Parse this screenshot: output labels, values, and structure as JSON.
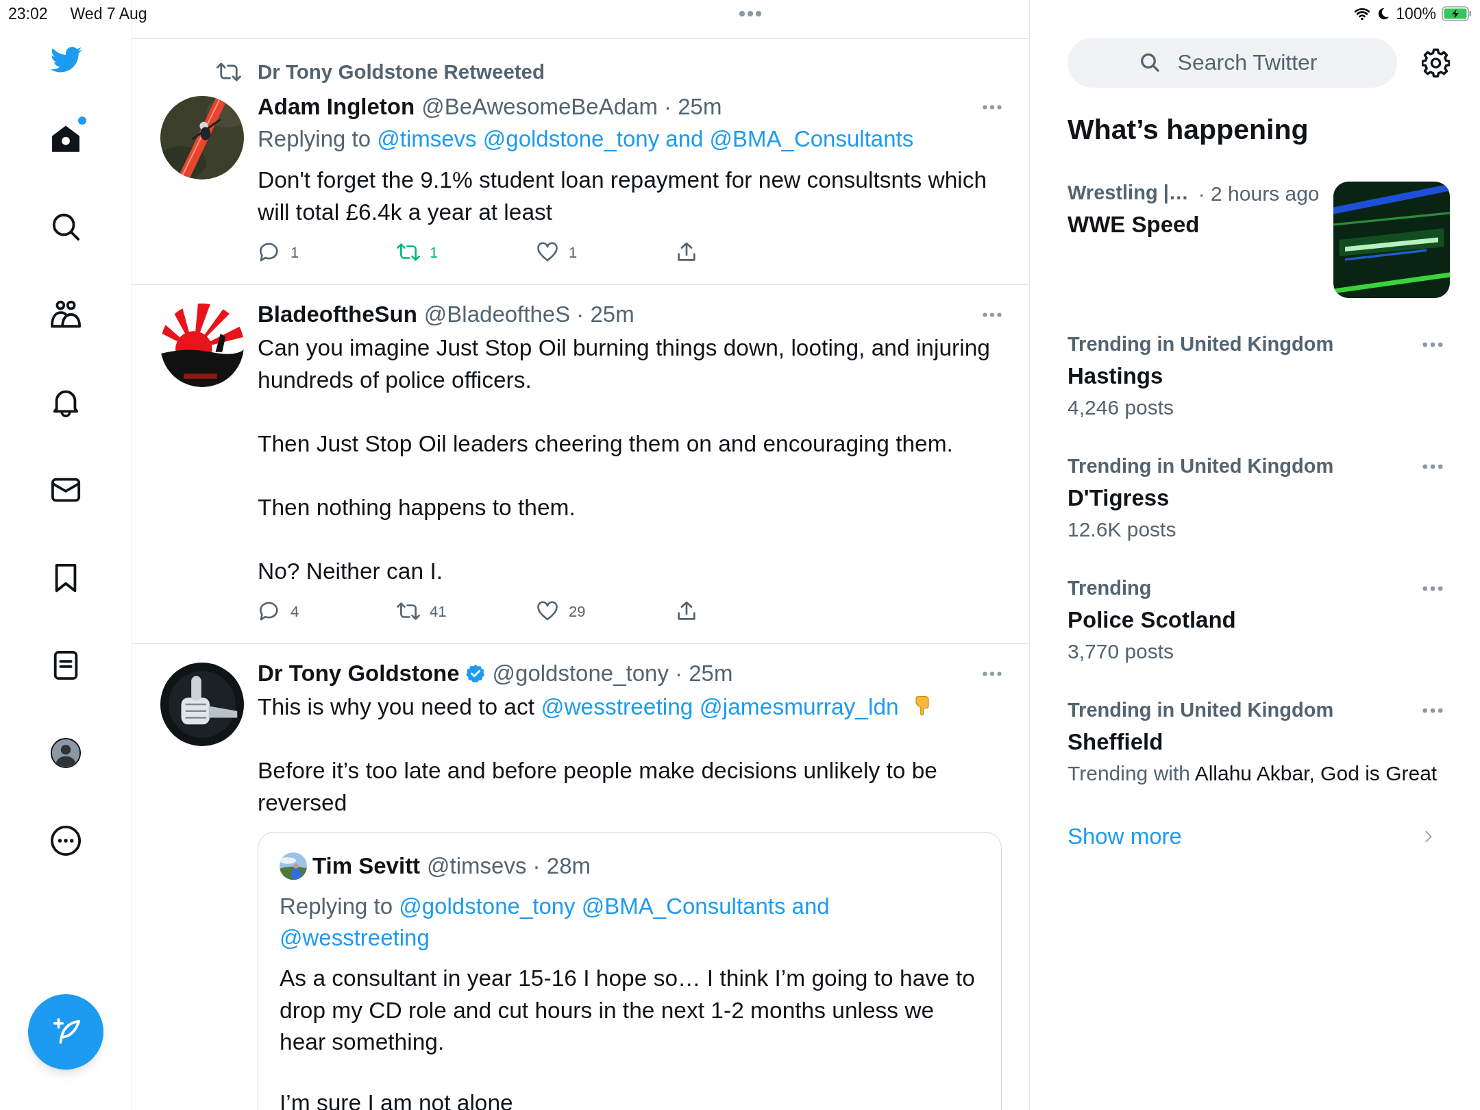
{
  "status_bar": {
    "time": "23:02",
    "date": "Wed 7 Aug",
    "battery": "100%"
  },
  "sidebar": {
    "items": [
      {
        "kind": "home",
        "selected": true,
        "unread": true
      },
      {
        "kind": "explore",
        "selected": false,
        "unread": false
      },
      {
        "kind": "communities",
        "selected": false,
        "unread": false
      },
      {
        "kind": "notifications",
        "selected": false,
        "unread": false
      },
      {
        "kind": "messages",
        "selected": false,
        "unread": false
      },
      {
        "kind": "bookmarks",
        "selected": false,
        "unread": false
      },
      {
        "kind": "lists",
        "selected": false,
        "unread": false
      },
      {
        "kind": "profile",
        "selected": false,
        "unread": false
      },
      {
        "kind": "more",
        "selected": false,
        "unread": false
      }
    ]
  },
  "feed": {
    "tweets": [
      {
        "retweeted_by": "Dr Tony Goldstone Retweeted",
        "name": "Adam Ingleton",
        "verified": false,
        "meta": "@BeAwesomeBeAdam · 25m",
        "replying_to": [
          {
            "kind": "plain",
            "text": "Replying to "
          },
          {
            "kind": "mention",
            "text": "@timsevs"
          },
          {
            "kind": "mention",
            "text": "@goldstone_tony"
          },
          {
            "kind": "accent",
            "text": " and "
          },
          {
            "kind": "mention",
            "text": "@BMA_Consultants"
          }
        ],
        "paragraphs": [
          [
            {
              "kind": "plain",
              "text": "Don't forget the 9.1% student loan repayment for new consultsnts which will total £6.4k a year at least"
            }
          ]
        ],
        "actions": {
          "replies": "1",
          "retweets": "1",
          "likes": "1",
          "retweeted": true,
          "liked": false
        }
      },
      {
        "name": "BladeoftheSun",
        "verified": false,
        "meta": "@BladeoftheS · 25m",
        "paragraphs": [
          [
            {
              "kind": "plain",
              "text": "Can you imagine Just Stop Oil burning things down, looting, and injuring hundreds of police officers."
            }
          ],
          [
            {
              "kind": "plain",
              "text": "Then Just Stop Oil leaders cheering them on and encouraging them."
            }
          ],
          [
            {
              "kind": "plain",
              "text": "Then nothing happens to them."
            }
          ],
          [
            {
              "kind": "plain",
              "text": "No? Neither can I."
            }
          ]
        ],
        "actions": {
          "replies": "4",
          "retweets": "41",
          "likes": "29",
          "retweeted": false,
          "liked": false
        }
      },
      {
        "name": "Dr Tony Goldstone",
        "verified": true,
        "meta": "@goldstone_tony · 25m",
        "paragraphs": [
          [
            {
              "kind": "plain",
              "text": "This is why you need to act "
            },
            {
              "kind": "mention",
              "text": "@wesstreeting"
            },
            {
              "kind": "mention",
              "text": "@jamesmurray_ldn"
            },
            {
              "kind": "hand_down"
            }
          ],
          [
            {
              "kind": "plain",
              "text": "Before it’s too late and before people make decisions unlikely to be reversed"
            }
          ]
        ],
        "quote": {
          "name": "Tim Sevitt",
          "meta": "@timsevs · 28m",
          "replying_to": [
            {
              "kind": "plain",
              "text": "Replying to "
            },
            {
              "kind": "mention",
              "text": "@goldstone_tony"
            },
            {
              "kind": "mention",
              "text": "@BMA_Consultants"
            },
            {
              "kind": "accent",
              "text": " and "
            },
            {
              "kind": "mention",
              "text": "@wesstreeting"
            }
          ],
          "paragraphs": [
            [
              {
                "kind": "plain",
                "text": "As a consultant in year 15-16 I hope so… I think I’m going to have to drop my CD role and cut hours in the next 1-2 months unless we hear something."
              }
            ],
            [
              {
                "kind": "plain",
                "text": "I’m sure I am not alone"
              }
            ]
          ]
        }
      }
    ]
  },
  "search": {
    "placeholder": "Search Twitter"
  },
  "trends": {
    "title": "What’s happening",
    "items": [
      {
        "category": "Wrestling |…",
        "time": "· 2 hours ago",
        "title": "WWE Speed",
        "has_picture": true,
        "menu": false
      },
      {
        "category": "Trending in United Kingdom",
        "title": "Hastings",
        "detail": [
          {
            "kind": "muted",
            "text": "4,246 posts"
          }
        ],
        "has_picture": false,
        "menu": true
      },
      {
        "category": "Trending in United Kingdom",
        "title": "D'Tigress",
        "detail": [
          {
            "kind": "muted",
            "text": "12.6K posts"
          }
        ],
        "has_picture": false,
        "menu": true
      },
      {
        "category": "Trending",
        "title": "Police Scotland",
        "detail": [
          {
            "kind": "muted",
            "text": "3,770 posts"
          }
        ],
        "has_picture": false,
        "menu": true
      },
      {
        "category": "Trending in United Kingdom",
        "title": "Sheffield",
        "detail": [
          {
            "kind": "muted",
            "text": "Trending with "
          },
          {
            "kind": "strong",
            "text": "Allahu Akbar, God is Great"
          }
        ],
        "has_picture": false,
        "menu": true
      }
    ],
    "show_more": "Show more"
  }
}
